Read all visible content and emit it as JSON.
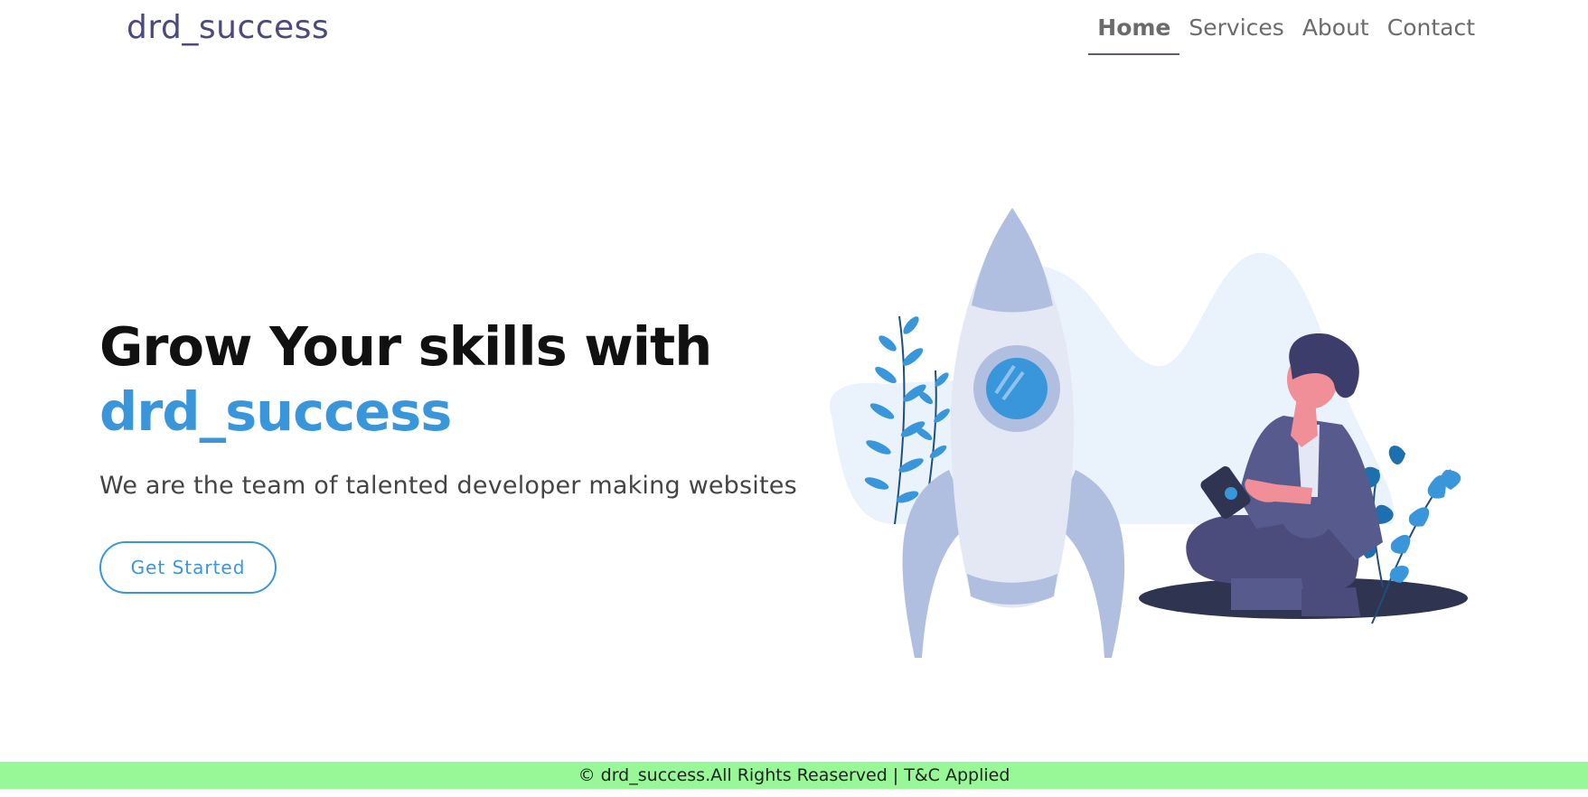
{
  "navbar": {
    "brand": "drd_success",
    "links": [
      {
        "label": "Home",
        "active": true
      },
      {
        "label": "Services",
        "active": false
      },
      {
        "label": "About",
        "active": false
      },
      {
        "label": "Contact",
        "active": false
      }
    ]
  },
  "hero": {
    "title_line1": "Grow Your skills with",
    "title_brand": "drd_success",
    "subtitle": "We are the team of talented developer making websites",
    "cta_label": "Get Started"
  },
  "footer": {
    "text": "© drd_success.All Rights Reaserved | T&C Applied"
  },
  "colors": {
    "brand_text": "#4a4a7c",
    "accent": "#3a96db",
    "footer_bg": "#98f898"
  },
  "illustration": {
    "icon": "rocket-launch-illustration"
  }
}
